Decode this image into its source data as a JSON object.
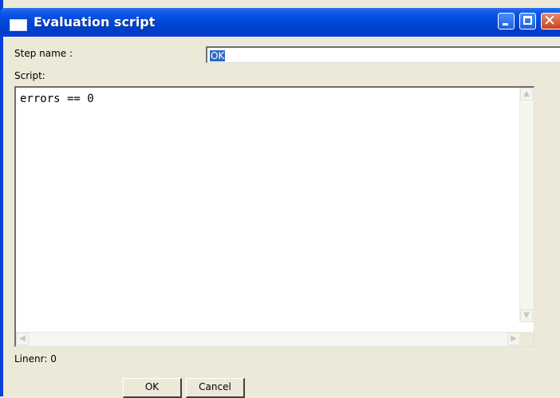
{
  "window": {
    "title": "Evaluation script"
  },
  "form": {
    "step_name_label": "Step name :",
    "step_name_value": "OK",
    "script_label": "Script:",
    "script_text": "errors == 0",
    "linenr_label": "Linenr: 0"
  },
  "buttons": {
    "ok": "OK",
    "cancel": "Cancel"
  },
  "icons": {
    "scroll_up": "▲",
    "scroll_down": "▼",
    "scroll_left": "◀",
    "scroll_right": "▶"
  },
  "colors": {
    "titlebar": "#0a55e5",
    "close": "#c6451f",
    "selection": "#316ac5",
    "face": "#ece9d8"
  }
}
